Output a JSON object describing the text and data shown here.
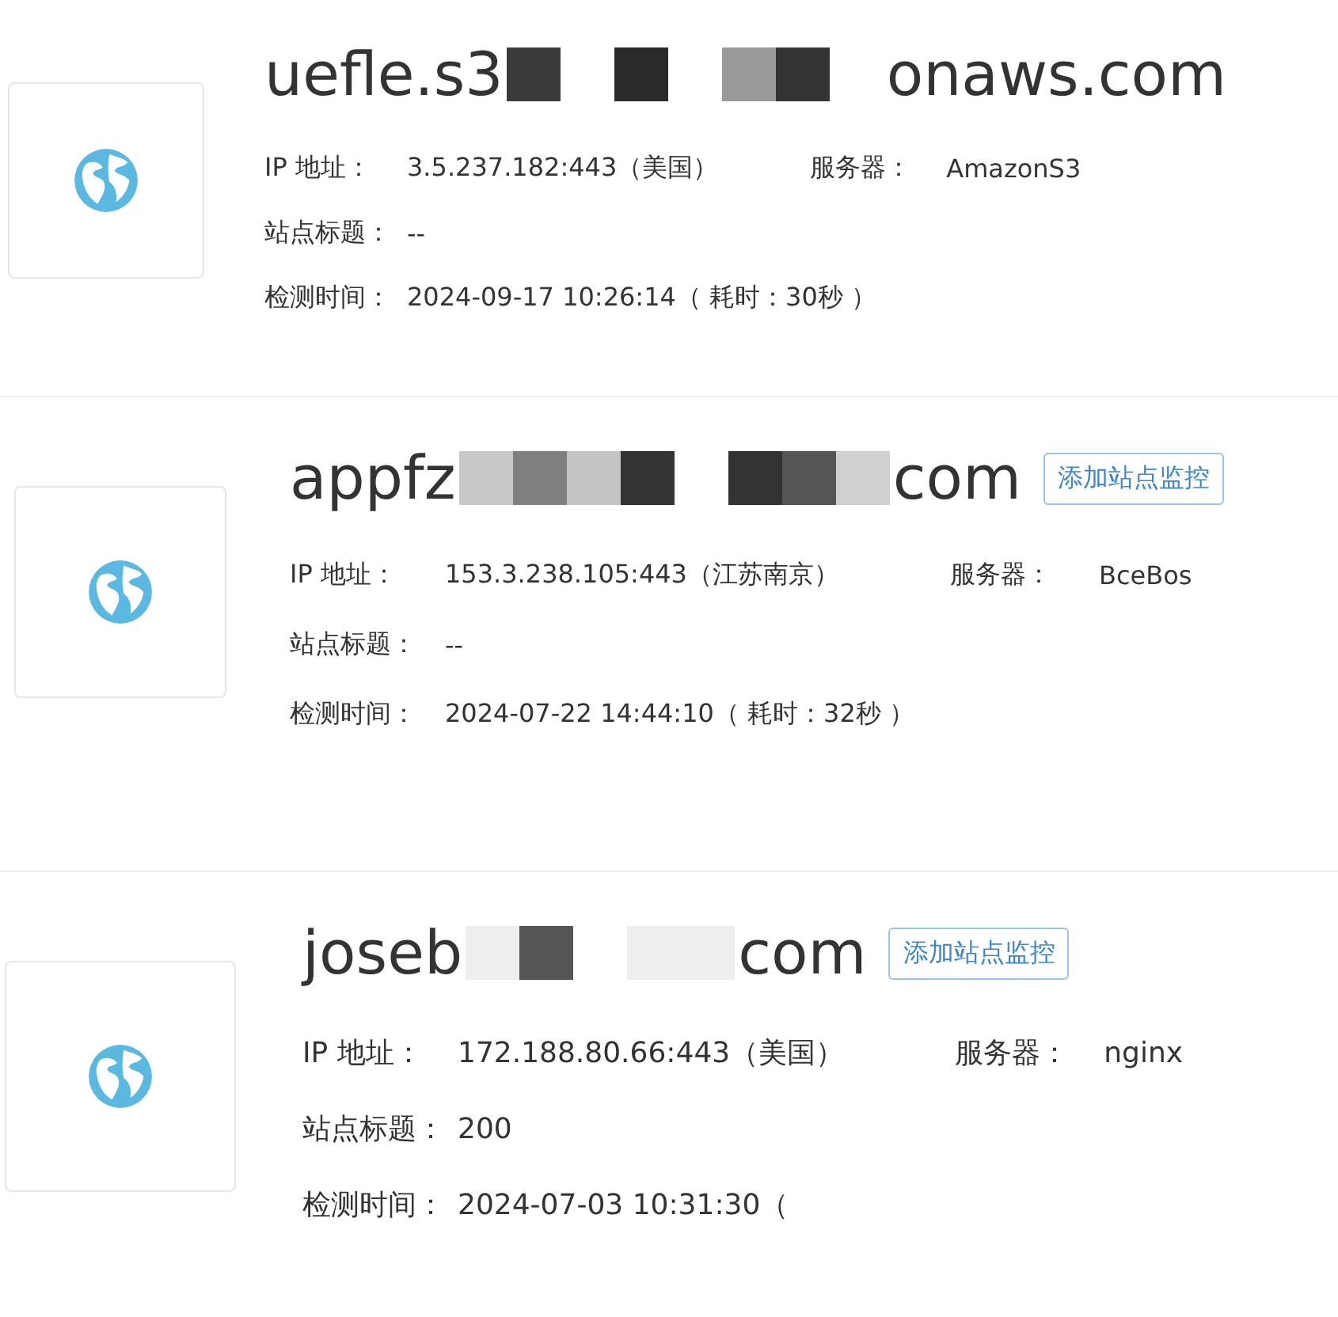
{
  "sites": [
    {
      "domain_start": "uefle.s3",
      "domain_end": "onaws.com",
      "ip_label": "IP 地址：",
      "ip": "3.5.237.182:443（美国）",
      "server_label": "服务器：",
      "server": "AmazonS3",
      "title_label": "站点标题：",
      "title": "--",
      "time_label": "检测时间：",
      "time": "2024-09-17 10:26:14（ 耗时：30秒 ）"
    },
    {
      "domain_start": "appfz",
      "domain_end": "com",
      "action": "添加站点监控",
      "ip_label": "IP 地址：",
      "ip": "153.3.238.105:443（江苏南京）",
      "server_label": "服务器：",
      "server": "BceBos",
      "title_label": "站点标题：",
      "title": "--",
      "time_label": "检测时间：",
      "time": "2024-07-22 14:44:10（ 耗时：32秒 ）"
    },
    {
      "domain_start": "joseb",
      "domain_end": "com",
      "action": "添加站点监控",
      "ip_label": "IP 地址：",
      "ip": "172.188.80.66:443（美国）",
      "server_label": "服务器：",
      "server": "nginx",
      "title_label": "站点标题：",
      "title": "200",
      "time_label": "检测时间：",
      "time": "2024-07-03 10:31:30（"
    }
  ]
}
